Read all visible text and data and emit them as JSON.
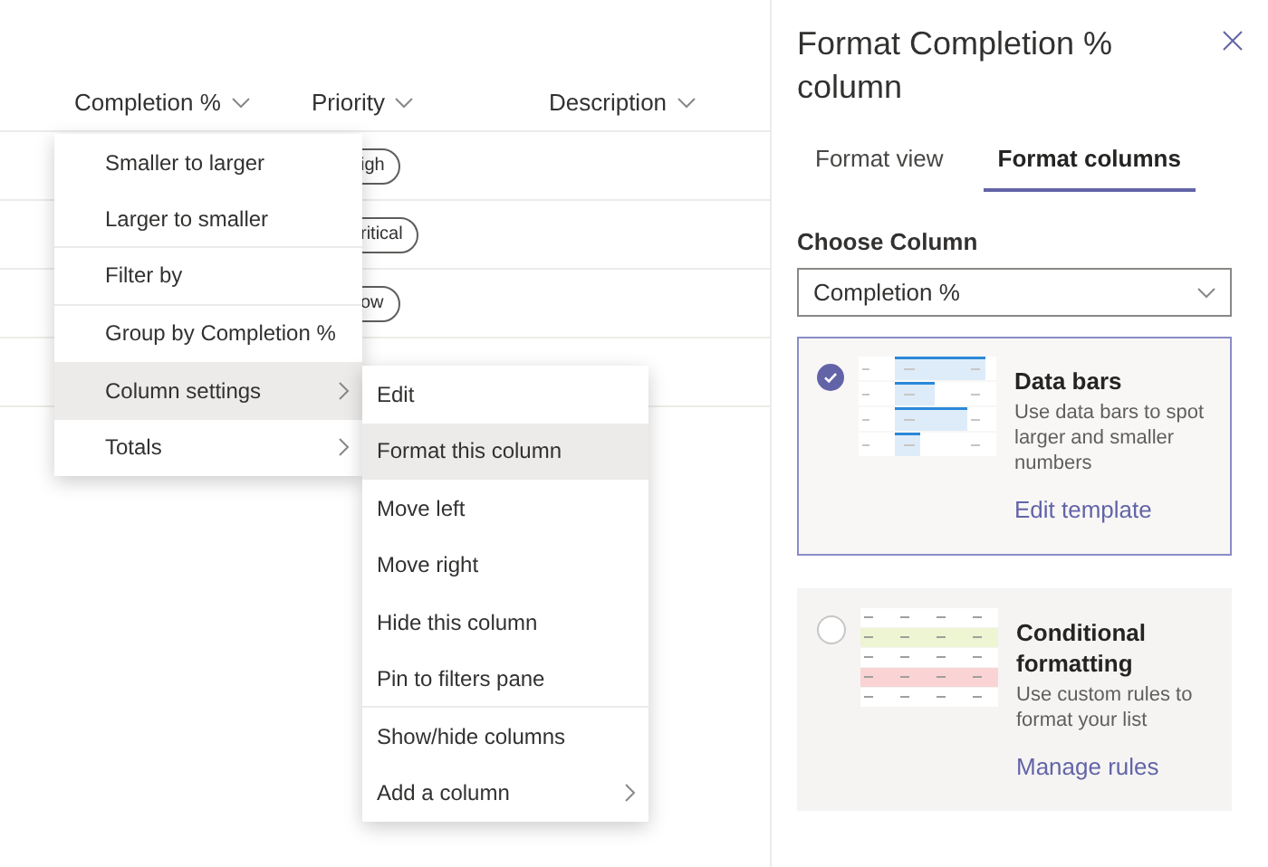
{
  "list": {
    "columns": [
      {
        "label": "Completion %"
      },
      {
        "label": "Priority"
      },
      {
        "label": "Description"
      }
    ],
    "rows": [
      {
        "priority": "igh"
      },
      {
        "priority": "ritical"
      },
      {
        "priority": "ow"
      }
    ]
  },
  "menu": {
    "items": [
      {
        "label": "Smaller to larger",
        "submenu": false,
        "selected": false,
        "divider_after": false
      },
      {
        "label": "Larger to smaller",
        "submenu": false,
        "selected": false,
        "divider_after": true
      },
      {
        "label": "Filter by",
        "submenu": false,
        "selected": false,
        "divider_after": true
      },
      {
        "label": "Group by Completion %",
        "submenu": false,
        "selected": false,
        "divider_after": false
      },
      {
        "label": "Column settings",
        "submenu": true,
        "selected": true,
        "divider_after": false
      },
      {
        "label": "Totals",
        "submenu": true,
        "selected": false,
        "divider_after": false
      }
    ]
  },
  "submenu": {
    "items": [
      {
        "label": "Edit",
        "submenu": false,
        "selected": false,
        "divider_after": false
      },
      {
        "label": "Format this column",
        "submenu": false,
        "selected": true,
        "divider_after": false
      },
      {
        "label": "Move left",
        "submenu": false,
        "selected": false,
        "divider_after": false
      },
      {
        "label": "Move right",
        "submenu": false,
        "selected": false,
        "divider_after": false
      },
      {
        "label": "Hide this column",
        "submenu": false,
        "selected": false,
        "divider_after": false
      },
      {
        "label": "Pin to filters pane",
        "submenu": false,
        "selected": false,
        "divider_after": true
      },
      {
        "label": "Show/hide columns",
        "submenu": false,
        "selected": false,
        "divider_after": false
      },
      {
        "label": "Add a column",
        "submenu": true,
        "selected": false,
        "divider_after": false
      }
    ]
  },
  "panel": {
    "title": "Format Completion % column",
    "tabs": [
      {
        "label": "Format view",
        "selected": false
      },
      {
        "label": "Format columns",
        "selected": true
      }
    ],
    "choose_label": "Choose Column",
    "dropdown": {
      "value": "Completion %"
    },
    "options": [
      {
        "kind": "databars",
        "title": "Data bars",
        "description": "Use data bars to spot larger and smaller numbers",
        "link": "Edit template",
        "selected": true
      },
      {
        "kind": "conditional",
        "title": "Conditional formatting",
        "description": "Use custom rules to format your list",
        "link": "Manage rules",
        "selected": false
      }
    ]
  }
}
